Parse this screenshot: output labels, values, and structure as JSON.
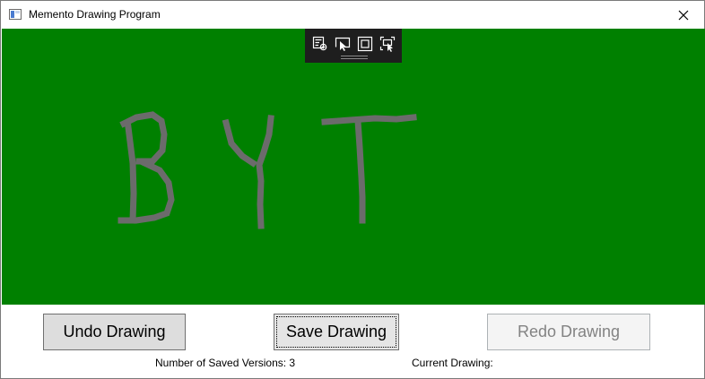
{
  "window": {
    "title": "Memento Drawing Program"
  },
  "canvas": {
    "background_color": "#008000",
    "stroke_color": "#6b6b6b",
    "toolbar_icons": [
      "inspect-tree-icon",
      "select-element-icon",
      "display-layout-adorners-icon",
      "track-focused-element-icon"
    ]
  },
  "buttons": {
    "undo_label": "Undo Drawing",
    "save_label": "Save Drawing",
    "redo_label": "Redo Drawing"
  },
  "status": {
    "saved_versions_text": "Number of Saved Versions: 3",
    "current_drawing_text": "Current Drawing:"
  }
}
